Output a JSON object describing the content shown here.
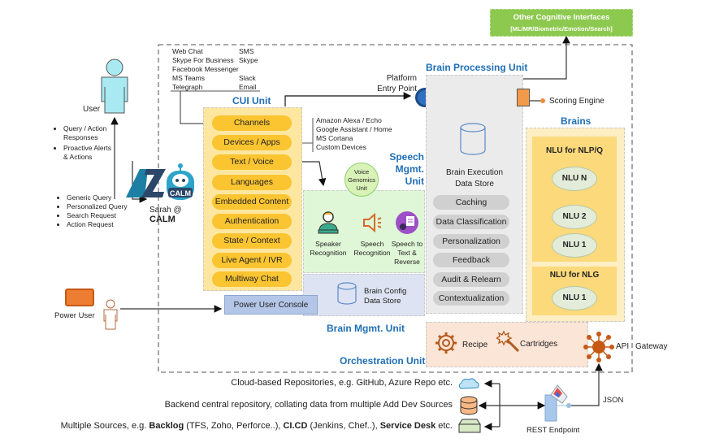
{
  "other_cognitive": {
    "title": "Other Cognitive Interfaces",
    "subtitle": "[ML/MR/Biometric/Emotion/Search]"
  },
  "user": {
    "label": "User",
    "responses": [
      "Query / Action Responses",
      "Proactive Alerts & Actions"
    ],
    "requests": [
      "Generic Query",
      "Personalized Query",
      "Search Request",
      "Action Request"
    ]
  },
  "bot": {
    "logo_text": "CALM",
    "name_line1": "Sarah @",
    "name_line2": "CALM"
  },
  "channels_list": {
    "col1": [
      "Web Chat",
      "Skype For Business",
      "Facebook Messenger",
      "MS Teams",
      "Telegraph"
    ],
    "col2": [
      "SMS",
      "Skype",
      "",
      "Slack",
      "Email"
    ]
  },
  "devices_list": [
    "Amazon Alexa / Echo",
    "Google Assistant / Home",
    "MS Cortana",
    "Custom Devices"
  ],
  "cui_unit": {
    "title": "CUI Unit",
    "items": [
      "Channels",
      "Devices / Apps",
      "Text / Voice",
      "Languages",
      "Embedded Content",
      "Authentication",
      "State / Context",
      "Live Agent / IVR",
      "Multiway Chat"
    ]
  },
  "platform_entry": {
    "line1": "Platform",
    "line2": "Entry Point"
  },
  "speech_unit": {
    "title_lines": [
      "Speech",
      "Mgmt.",
      "Unit"
    ],
    "voice_genomics": [
      "Voice",
      "Genomics",
      "Unit"
    ],
    "items": [
      {
        "icon": "speaker-person-icon",
        "lines": [
          "Speaker",
          "Recognition"
        ]
      },
      {
        "icon": "speaker-sound-icon",
        "lines": [
          "Speech",
          "Recognition"
        ]
      },
      {
        "icon": "speech-to-text-icon",
        "lines": [
          "Speech to",
          "Text &",
          "Reverse"
        ]
      }
    ]
  },
  "brain_mgmt": {
    "title": "Brain Mgmt. Unit",
    "store_lines": [
      "Brain Config",
      "Data Store"
    ],
    "console": "Power User Console"
  },
  "power_user": {
    "label": "Power User"
  },
  "bpu": {
    "title": "Brain Processing Unit",
    "store_lines": [
      "Brain Execution",
      "Data Store"
    ],
    "items": [
      "Caching",
      "Data Classification",
      "Personalization",
      "Feedback",
      "Audit & Relearn",
      "Contextualization"
    ]
  },
  "scoring_engine": "Scoring Engine",
  "brains": {
    "title": "Brains",
    "nlp": {
      "title": "NLU for NLP/Q",
      "nodes": [
        "NLU  N",
        "NLU  2",
        "NLU  1"
      ]
    },
    "nlg": {
      "title": "NLU for NLG",
      "nodes": [
        "NLU  1"
      ]
    }
  },
  "orchestration": {
    "title": "Orchestration Unit",
    "recipe": "Recipe",
    "cartridges": "Cartridges"
  },
  "api_gateway": {
    "api": "API",
    "gateway": "Gateway"
  },
  "json_label": "JSON",
  "rest_endpoint": "REST Endpoint",
  "sources": {
    "cloud": "Cloud-based Repositories, e.g. GitHub, Azure Repo etc.",
    "backend": "Backend central repository, collating data from multiple Add Dev Sources",
    "multi": {
      "prefix": "Multiple Sources, e.g. ",
      "b1": "Backlog",
      "t1": " (TFS, Zoho, Perforce..), ",
      "b2": "CI.CD",
      "t2": " (Jenkins, Chef..), ",
      "b3": "Service Desk",
      "t3": " etc."
    }
  },
  "colors": {
    "accent_blue": "#1f6fb5",
    "cui_yellow": "#fbc531",
    "speech_green": "#dff7d6",
    "brain_mgmt_blue": "#dde3f3",
    "bpu_gray": "#ebebeb",
    "brains_yellow": "#fde28a",
    "orch_peach": "#fbe5d6",
    "cognitive_green": "#8dc94f",
    "orange": "#ed8b3a"
  }
}
